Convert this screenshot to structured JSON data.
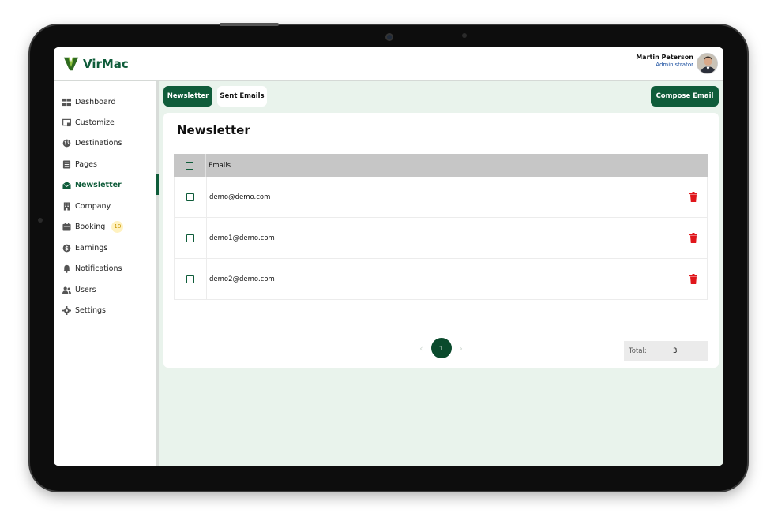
{
  "brand": {
    "name": "VirMac",
    "accent": "#0f5c3a"
  },
  "user": {
    "name": "Martin Peterson",
    "role": "Administrator"
  },
  "sidebar": {
    "items": [
      {
        "label": "Dashboard",
        "icon": "dashboard-icon"
      },
      {
        "label": "Customize",
        "icon": "customize-icon"
      },
      {
        "label": "Destinations",
        "icon": "globe-icon"
      },
      {
        "label": "Pages",
        "icon": "pages-icon"
      },
      {
        "label": "Newsletter",
        "icon": "newsletter-icon",
        "active": true
      },
      {
        "label": "Company",
        "icon": "building-icon"
      },
      {
        "label": "Booking",
        "icon": "booking-icon",
        "badge": "10"
      },
      {
        "label": "Earnings",
        "icon": "dollar-icon"
      },
      {
        "label": "Notifications",
        "icon": "bell-icon"
      },
      {
        "label": "Users",
        "icon": "users-icon"
      },
      {
        "label": "Settings",
        "icon": "gear-icon"
      }
    ]
  },
  "tabs": {
    "newsletter": "Newsletter",
    "sent": "Sent Emails"
  },
  "compose_label": "Compose Email",
  "card": {
    "title": "Newsletter"
  },
  "table": {
    "header": "Emails",
    "rows": [
      "demo@demo.com",
      "demo1@demo.com",
      "demo2@demo.com"
    ]
  },
  "total": {
    "label": "Total:",
    "value": "3"
  },
  "pagination": {
    "current": "1",
    "prev": "‹",
    "next": "›"
  }
}
